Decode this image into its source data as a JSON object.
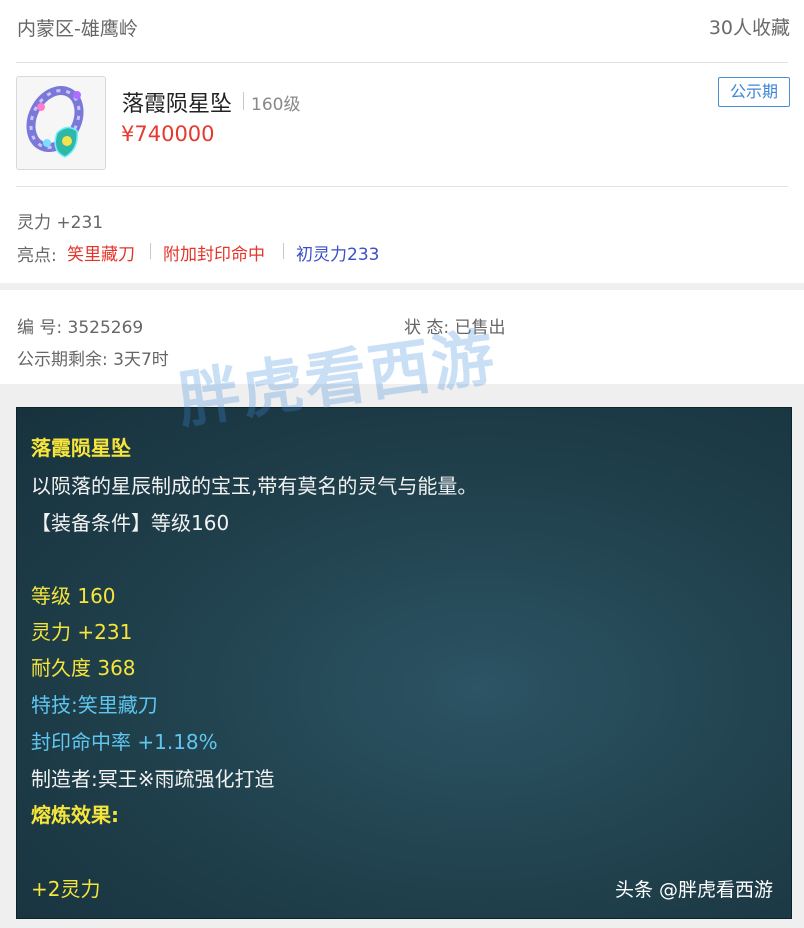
{
  "header": {
    "server": "内蒙区-雄鹰岭",
    "favorites": "30人收藏"
  },
  "item": {
    "name": "落霞陨星坠",
    "level": "160级",
    "price": "¥740000",
    "badge": "公示期",
    "icon": "jade-pendant-icon"
  },
  "attributes": {
    "spirit": "灵力 +231",
    "highlights_label": "亮点:",
    "highlights": [
      "笑里藏刀",
      "附加封印命中",
      "初灵力233"
    ],
    "highlight_colors": [
      "#e5352b",
      "#e5352b",
      "#3b4fc6"
    ]
  },
  "info": {
    "serial": "编 号: 3525269",
    "status": "状 态: 已售出",
    "remaining": "公示期剩余: 3天7时"
  },
  "tooltip": {
    "title": "落霞陨星坠",
    "description": "以陨落的星辰制成的宝玉,带有莫名的灵气与能量。",
    "requirement": "【装备条件】等级160",
    "level": "等级 160",
    "spirit": "灵力 +231",
    "durability": "耐久度 368",
    "special_skill": "特技:笑里藏刀",
    "seal_hit": "封印命中率 +1.18%",
    "maker": "制造者:冥王※雨疏强化打造",
    "refine_label": "熔炼效果:",
    "refine_value": "+2灵力"
  },
  "watermark": "胖虎看西游",
  "source_credit": "头条 @胖虎看西游"
}
